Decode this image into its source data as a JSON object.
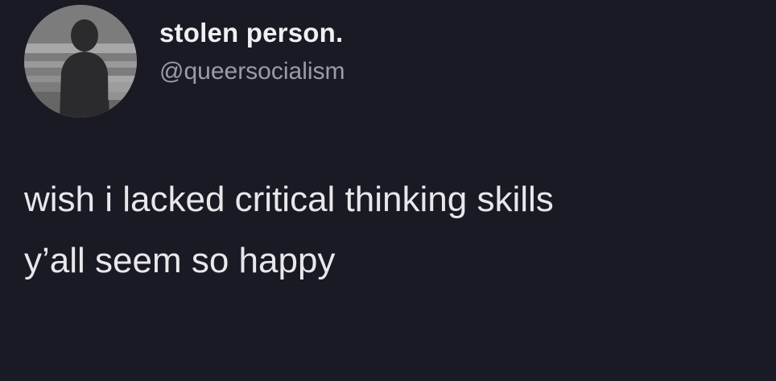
{
  "author": {
    "display_name": "stolen person.",
    "handle": "@queersocialism",
    "avatar_icon": "person-silhouette-avatar"
  },
  "tweet": {
    "lines": [
      "wish i lacked critical thinking skills",
      "y’all seem so happy"
    ]
  },
  "colors": {
    "background": "#191a24",
    "text_primary": "#f0f0f2",
    "text_secondary": "#9a9ca6"
  }
}
